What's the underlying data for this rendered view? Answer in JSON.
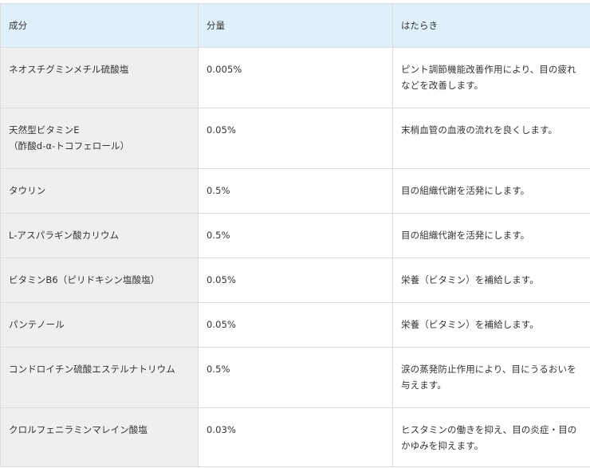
{
  "table": {
    "headers": {
      "name": "成分",
      "amount": "分量",
      "effect": "はたらき"
    },
    "rows": [
      {
        "name": "ネオスチグミンメチル硫酸塩",
        "amount": "0.005%",
        "effect": "ピント調節機能改善作用により、目の疲れ\nなどを改善します。"
      },
      {
        "name": "天然型ビタミンE\n（酢酸d-α-トコフェロール）",
        "amount": "0.05%",
        "effect": "末梢血管の血液の流れを良くします。"
      },
      {
        "name": "タウリン",
        "amount": "0.5%",
        "effect": "目の組織代謝を活発にします。"
      },
      {
        "name": "L-アスパラギン酸カリウム",
        "amount": "0.5%",
        "effect": "目の組織代謝を活発にします。"
      },
      {
        "name": "ビタミンB6（ピリドキシン塩酸塩）",
        "amount": "0.05%",
        "effect": "栄養（ビタミン）を補給します。"
      },
      {
        "name": "パンテノール",
        "amount": "0.05%",
        "effect": "栄養（ビタミン）を補給します。"
      },
      {
        "name": "コンドロイチン硫酸エステルナトリウム",
        "amount": "0.5%",
        "effect": "涙の蒸発防止作用により、目にうるおいを\n与えます。"
      },
      {
        "name": "クロルフェニラミンマレイン酸塩",
        "amount": "0.03%",
        "effect": "ヒスタミンの働きを抑え、目の炎症・目の\nかゆみを抑えます。"
      }
    ]
  }
}
